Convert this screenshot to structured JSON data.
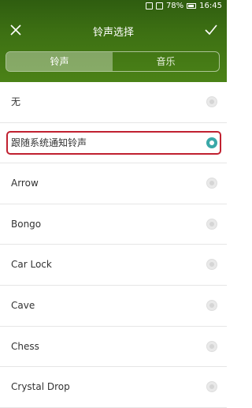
{
  "status_bar": {
    "battery": "78%",
    "time": "16:45"
  },
  "header": {
    "title": "铃声选择"
  },
  "tabs": [
    {
      "label": "铃声",
      "active": true
    },
    {
      "label": "音乐",
      "active": false
    }
  ],
  "ringtones": [
    {
      "label": "无",
      "selected": false
    },
    {
      "label": "跟随系统通知铃声",
      "selected": true
    },
    {
      "label": "Arrow",
      "selected": false
    },
    {
      "label": "Bongo",
      "selected": false
    },
    {
      "label": "Car Lock",
      "selected": false
    },
    {
      "label": "Cave",
      "selected": false
    },
    {
      "label": "Chess",
      "selected": false
    },
    {
      "label": "Crystal Drop",
      "selected": false
    }
  ],
  "colors": {
    "header_green": "#3d7013",
    "accent_teal": "#3aa8a8",
    "highlight_red": "#c02030"
  }
}
